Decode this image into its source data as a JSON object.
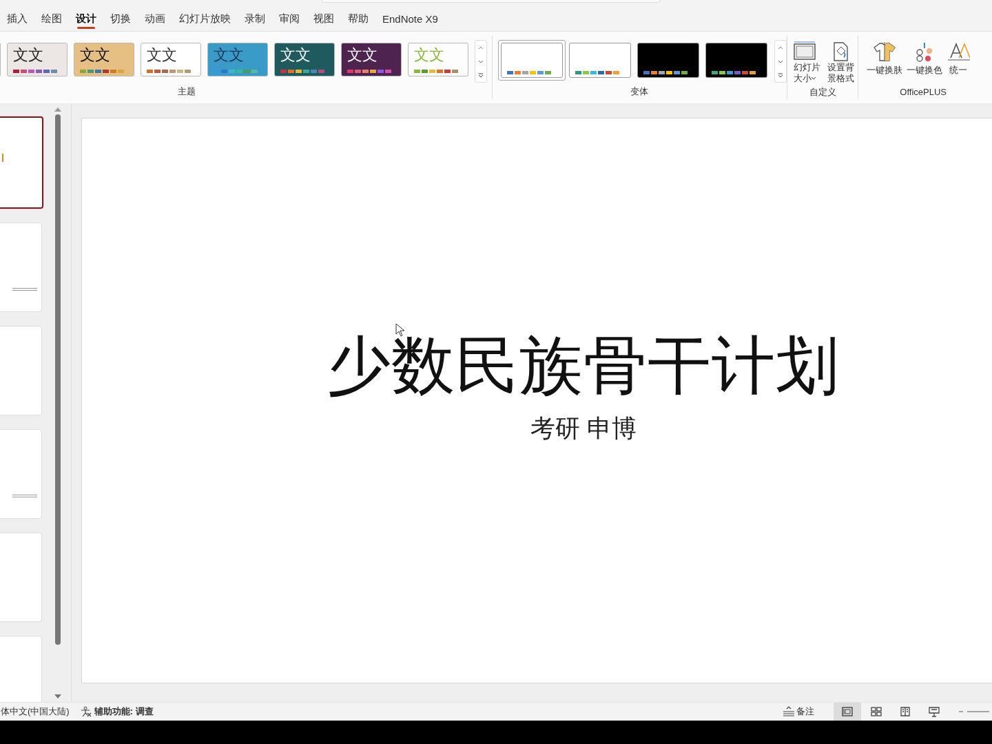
{
  "menu_tabs": [
    {
      "label": "插入",
      "selected": false
    },
    {
      "label": "绘图",
      "selected": false
    },
    {
      "label": "设计",
      "selected": true
    },
    {
      "label": "切换",
      "selected": false
    },
    {
      "label": "动画",
      "selected": false
    },
    {
      "label": "幻灯片放映",
      "selected": false
    },
    {
      "label": "录制",
      "selected": false
    },
    {
      "label": "审阅",
      "selected": false
    },
    {
      "label": "视图",
      "selected": false
    },
    {
      "label": "帮助",
      "selected": false
    },
    {
      "label": "EndNote X9",
      "selected": false
    }
  ],
  "themes": {
    "label": "主题",
    "items": [
      {
        "sample": {
          "text": "文文",
          "color": "#222222"
        },
        "color": "#ece6e4",
        "swatches": [
          {
            "color": "#a8203a"
          },
          {
            "color": "#d04a7a"
          },
          {
            "color": "#b45ab8"
          },
          {
            "color": "#8a5ab8"
          },
          {
            "color": "#5a6ab8"
          },
          {
            "color": "#6a90b0"
          }
        ]
      },
      {
        "sample": {
          "text": "文文",
          "color": "#111111"
        },
        "color": "#e6bf84",
        "swatches": [
          {
            "color": "#8aa83a"
          },
          {
            "color": "#4a9a7a"
          },
          {
            "color": "#3a7aa8"
          },
          {
            "color": "#a83a3a"
          },
          {
            "color": "#d07a2a"
          },
          {
            "color": "#d8a83a"
          }
        ]
      },
      {
        "sample": {
          "text": "文文",
          "color": "#333333"
        },
        "color": "#ffffff",
        "swatches": [
          {
            "color": "#d0702a"
          },
          {
            "color": "#c05a3a"
          },
          {
            "color": "#a86a4a"
          },
          {
            "color": "#b89a7a"
          },
          {
            "color": "#c8b88a"
          },
          {
            "color": "#a8a07a"
          }
        ]
      },
      {
        "sample": {
          "text": "文文",
          "color": "#1a3a5a"
        },
        "color": "#3a9ac8",
        "swatches": [
          {
            "color": "#3a9ad8"
          },
          {
            "color": "#2a7ac8"
          },
          {
            "color": "#3ab8c8"
          },
          {
            "color": "#3ab898"
          },
          {
            "color": "#4a9a5a"
          },
          {
            "color": "#5ab8a8"
          }
        ]
      },
      {
        "sample": {
          "text": "文文",
          "color": "#ffffff"
        },
        "color": "#1f5a5e",
        "swatches": [
          {
            "color": "#c8303a"
          },
          {
            "color": "#e0702a"
          },
          {
            "color": "#e8b83a"
          },
          {
            "color": "#3aa8a0"
          },
          {
            "color": "#4a8ab0"
          },
          {
            "color": "#b0507a"
          }
        ]
      },
      {
        "sample": {
          "text": "文文",
          "color": "#fefefe"
        },
        "color": "#4e2350",
        "swatches": [
          {
            "color": "#d83a6a"
          },
          {
            "color": "#e05a7a"
          },
          {
            "color": "#e8806a"
          },
          {
            "color": "#e8a83a"
          },
          {
            "color": "#8a5ad8"
          },
          {
            "color": "#d050b0"
          }
        ]
      },
      {
        "sample": {
          "text": "文文",
          "color": "#8ab83a"
        },
        "color": "#fdfdfd",
        "swatches": [
          {
            "color": "#8ab83b"
          },
          {
            "color": "#5a9a3a"
          },
          {
            "color": "#e8b83b"
          },
          {
            "color": "#e0702b"
          },
          {
            "color": "#c83a3a"
          },
          {
            "color": "#a8906a"
          }
        ]
      }
    ]
  },
  "variants": {
    "label": "变体",
    "items": [
      {
        "selected": true,
        "color": "#ffffff",
        "swatches": [
          {
            "color": "#4472c4"
          },
          {
            "color": "#ed7d31"
          },
          {
            "color": "#a5a5a5"
          },
          {
            "color": "#ffc000"
          },
          {
            "color": "#5b9bd5"
          },
          {
            "color": "#70ad47"
          }
        ]
      },
      {
        "selected": false,
        "color": "#ffffff",
        "swatches": [
          {
            "color": "#2a9a7a"
          },
          {
            "color": "#8ac84a"
          },
          {
            "color": "#3ab8d8"
          },
          {
            "color": "#2a6aa8"
          },
          {
            "color": "#c84a2a"
          },
          {
            "color": "#f0a030"
          }
        ]
      },
      {
        "selected": false,
        "color": "#000000",
        "swatches": [
          {
            "color": "#4472c4"
          },
          {
            "color": "#ed7d31"
          },
          {
            "color": "#a5a5a5"
          },
          {
            "color": "#ffc000"
          },
          {
            "color": "#5b9bd5"
          },
          {
            "color": "#70ad47"
          }
        ]
      },
      {
        "selected": false,
        "color": "#000000",
        "swatches": [
          {
            "color": "#3aa88a"
          },
          {
            "color": "#8ac84a"
          },
          {
            "color": "#3a9ad8"
          },
          {
            "color": "#7a5ac8"
          },
          {
            "color": "#c84a3a"
          },
          {
            "color": "#e0a040"
          }
        ]
      }
    ]
  },
  "customize": {
    "label": "自定义",
    "buttons": [
      {
        "label": "幻灯片大小",
        "dropdown": true
      },
      {
        "label": "设置背景格式",
        "dropdown": false
      }
    ]
  },
  "officeplus": {
    "label": "OfficePLUS",
    "buttons": [
      {
        "label": "一键换肤"
      },
      {
        "label": "一键换色"
      },
      {
        "label": "统一"
      }
    ]
  },
  "slides": [
    {
      "selected": true
    },
    {
      "selected": false
    },
    {
      "selected": false
    },
    {
      "selected": false
    },
    {
      "selected": false
    },
    {
      "selected": false
    }
  ],
  "slide": {
    "title": "少数民族骨干计划",
    "subtitle": "考研 申博"
  },
  "status_bar": {
    "language": "体中文(中国大陆)",
    "accessibility": "辅助功能: 调查",
    "notes": "备注",
    "views": [
      {
        "kind": "normal",
        "selected": true
      },
      {
        "kind": "sorter",
        "selected": false
      },
      {
        "kind": "reading",
        "selected": false
      },
      {
        "kind": "slideshow",
        "selected": false
      }
    ]
  }
}
